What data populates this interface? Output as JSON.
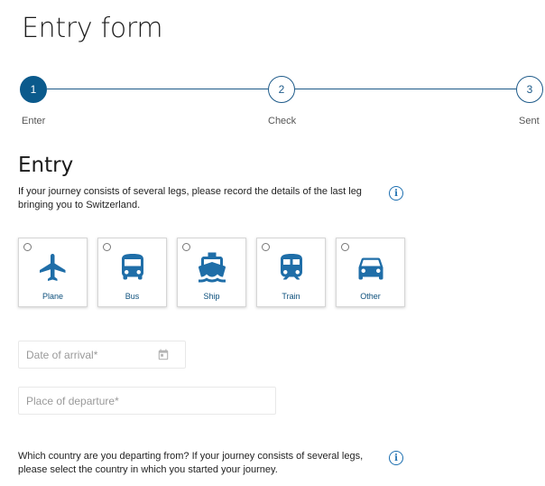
{
  "page": {
    "title": "Entry form"
  },
  "stepper": {
    "steps": [
      {
        "number": "1",
        "label": "Enter",
        "state": "active"
      },
      {
        "number": "2",
        "label": "Check",
        "state": "idle"
      },
      {
        "number": "3",
        "label": "Sent",
        "state": "idle"
      }
    ]
  },
  "entry": {
    "title": "Entry",
    "help_text": "If your journey consists of several legs, please record the details of the last leg bringing you to Switzerland.",
    "info_icon": "info-icon",
    "transport_options": [
      {
        "label": "Plane",
        "icon": "plane-icon",
        "selected": false
      },
      {
        "label": "Bus",
        "icon": "bus-icon",
        "selected": false
      },
      {
        "label": "Ship",
        "icon": "ship-icon",
        "selected": false
      },
      {
        "label": "Train",
        "icon": "train-icon",
        "selected": false
      },
      {
        "label": "Other",
        "icon": "car-icon",
        "selected": false
      }
    ],
    "date_of_arrival": {
      "placeholder": "Date of arrival*",
      "value": ""
    },
    "place_of_departure": {
      "placeholder": "Place of departure*",
      "value": ""
    },
    "country_help_text": "Which country are you departing from? If your journey consists of several legs, please select the country in which you started your journey."
  },
  "colors": {
    "primary": "#0b5a8c",
    "icon_blue": "#1f6ea8",
    "info_blue": "#1d6fb0"
  }
}
